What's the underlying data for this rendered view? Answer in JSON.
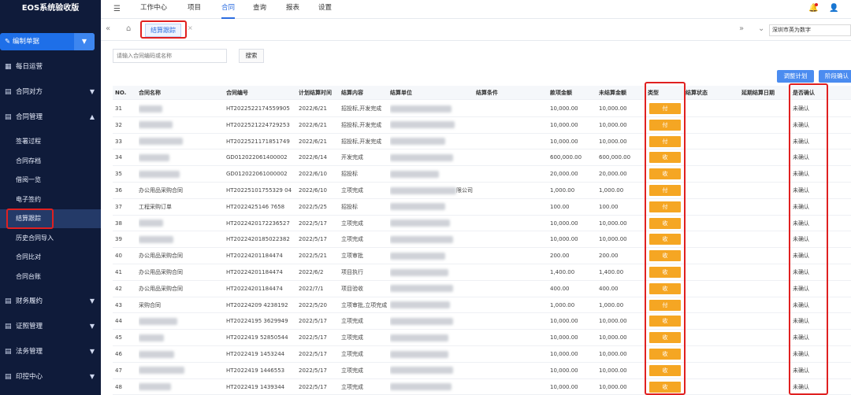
{
  "app": {
    "title": "EOS系统验收版"
  },
  "sidebar": {
    "workspace_button": "✎ 编制单据",
    "items_top": [
      {
        "icon": "grid-icon",
        "label": "每日运营"
      },
      {
        "icon": "document-icon",
        "label": "合同对方"
      },
      {
        "icon": "document-icon",
        "label": "合同管理"
      }
    ],
    "sub_items": [
      "签署过程",
      "合同存档",
      "借阅一览",
      "电子签约",
      "结算跟踪",
      "历史合同导入",
      "合同比对",
      "合同台账"
    ],
    "items_bottom": [
      {
        "icon": "document-icon",
        "label": "财务履约"
      },
      {
        "icon": "document-icon",
        "label": "证照管理"
      },
      {
        "icon": "document-icon",
        "label": "法务管理"
      },
      {
        "icon": "document-icon",
        "label": "印控中心"
      }
    ]
  },
  "topnav": {
    "items": [
      "工作中心",
      "项目",
      "合同",
      "查询",
      "报表",
      "设置"
    ],
    "active": "合同"
  },
  "tabs": {
    "active_label": "结算跟踪",
    "tenant": "深圳市英为数字"
  },
  "toolbar": {
    "search_placeholder": "请输入合同编码或名称",
    "search_label": "搜索",
    "adjust_plan_label": "调整计划",
    "stage_confirm_label": "阶段确认"
  },
  "table": {
    "headers": [
      "NO.",
      "合同名称",
      "合同编号",
      "计划结算时间",
      "结算内容",
      "结算单位",
      "结算条件",
      "款项金额",
      "未结算金额",
      "类型",
      "结算状态",
      "延期结算日期",
      "是否确认"
    ],
    "rows": [
      {
        "no": "31",
        "name": "",
        "code": "HT2022522174559905",
        "date": "2022/6/21",
        "content": "招投标,开发完成",
        "unit": "",
        "cond": "",
        "amount": "10,000.00",
        "unpaid": "10,000.00",
        "type": "付",
        "status": "",
        "delay": "",
        "confirm": "未确认"
      },
      {
        "no": "32",
        "name": "",
        "code": "HT2022521224729253",
        "date": "2022/6/21",
        "content": "招投标,开发完成",
        "unit": "",
        "cond": "",
        "amount": "10,000.00",
        "unpaid": "10,000.00",
        "type": "付",
        "status": "",
        "delay": "",
        "confirm": "未确认"
      },
      {
        "no": "33",
        "name": "",
        "code": "HT2022521171851749",
        "date": "2022/6/21",
        "content": "招投标,开发完成",
        "unit": "",
        "cond": "",
        "amount": "10,000.00",
        "unpaid": "10,000.00",
        "type": "付",
        "status": "",
        "delay": "",
        "confirm": "未确认"
      },
      {
        "no": "34",
        "name": "",
        "code": "GD012022061400002",
        "date": "2022/6/14",
        "content": "开发完成",
        "unit": "",
        "cond": "",
        "amount": "600,000.00",
        "unpaid": "600,000.00",
        "type": "收",
        "status": "",
        "delay": "",
        "confirm": "未确认"
      },
      {
        "no": "35",
        "name": "",
        "code": "GD012022061000002",
        "date": "2022/6/10",
        "content": "招投标",
        "unit": "",
        "cond": "",
        "amount": "20,000.00",
        "unpaid": "20,000.00",
        "type": "收",
        "status": "",
        "delay": "",
        "confirm": "未确认"
      },
      {
        "no": "36",
        "name": "办公用品采购合同",
        "code": "HT20225101755329 04",
        "date": "2022/6/10",
        "content": "立项完成",
        "unit": "",
        "unit_suffix": "限公司",
        "cond": "",
        "amount": "1,000.00",
        "unpaid": "1,000.00",
        "type": "付",
        "status": "",
        "delay": "",
        "confirm": "未确认"
      },
      {
        "no": "37",
        "name": "工程采购订单",
        "code": "HT2022425146 7658",
        "date": "2022/5/25",
        "content": "招投标",
        "unit": "",
        "cond": "",
        "amount": "100.00",
        "unpaid": "100.00",
        "type": "付",
        "status": "",
        "delay": "",
        "confirm": "未确认"
      },
      {
        "no": "38",
        "name": "",
        "code": "HT2022420172236527",
        "date": "2022/5/17",
        "content": "立项完成",
        "unit": "",
        "cond": "",
        "amount": "10,000.00",
        "unpaid": "10,000.00",
        "type": "收",
        "status": "",
        "delay": "",
        "confirm": "未确认"
      },
      {
        "no": "39",
        "name": "",
        "code": "HT2022420185022382",
        "date": "2022/5/17",
        "content": "立项完成",
        "unit": "",
        "cond": "",
        "amount": "10,000.00",
        "unpaid": "10,000.00",
        "type": "收",
        "status": "",
        "delay": "",
        "confirm": "未确认"
      },
      {
        "no": "40",
        "name": "办公用品采购合同",
        "code": "HT20224201184474",
        "date": "2022/5/21",
        "content": "立项审批",
        "unit": "",
        "cond": "",
        "amount": "200.00",
        "unpaid": "200.00",
        "type": "收",
        "status": "",
        "delay": "",
        "confirm": "未确认"
      },
      {
        "no": "41",
        "name": "办公用品采购合同",
        "code": "HT20224201184474",
        "date": "2022/6/2",
        "content": "项目执行",
        "unit": "",
        "cond": "",
        "amount": "1,400.00",
        "unpaid": "1,400.00",
        "type": "收",
        "status": "",
        "delay": "",
        "confirm": "未确认"
      },
      {
        "no": "42",
        "name": "办公用品采购合同",
        "code": "HT20224201184474",
        "date": "2022/7/1",
        "content": "项目验收",
        "unit": "",
        "cond": "",
        "amount": "400.00",
        "unpaid": "400.00",
        "type": "收",
        "status": "",
        "delay": "",
        "confirm": "未确认"
      },
      {
        "no": "43",
        "name": "采购合同",
        "code": "HT20224209 4238192",
        "date": "2022/5/20",
        "content": "立项审批,立项完成",
        "unit": "",
        "cond": "",
        "amount": "1,000.00",
        "unpaid": "1,000.00",
        "type": "付",
        "status": "",
        "delay": "",
        "confirm": "未确认"
      },
      {
        "no": "44",
        "name": "",
        "code": "HT20224195 3629949",
        "date": "2022/5/17",
        "content": "立项完成",
        "unit": "",
        "cond": "",
        "amount": "10,000.00",
        "unpaid": "10,000.00",
        "type": "收",
        "status": "",
        "delay": "",
        "confirm": "未确认"
      },
      {
        "no": "45",
        "name": "",
        "code": "HT2022419 52850544",
        "date": "2022/5/17",
        "content": "立项完成",
        "unit": "",
        "cond": "",
        "amount": "10,000.00",
        "unpaid": "10,000.00",
        "type": "收",
        "status": "",
        "delay": "",
        "confirm": "未确认"
      },
      {
        "no": "46",
        "name": "",
        "code": "HT2022419 1453244",
        "date": "2022/5/17",
        "content": "立项完成",
        "unit": "",
        "cond": "",
        "amount": "10,000.00",
        "unpaid": "10,000.00",
        "type": "收",
        "status": "",
        "delay": "",
        "confirm": "未确认"
      },
      {
        "no": "47",
        "name": "",
        "code": "HT2022419 1446553",
        "date": "2022/5/17",
        "content": "立项完成",
        "unit": "",
        "cond": "",
        "amount": "10,000.00",
        "unpaid": "10,000.00",
        "type": "收",
        "status": "",
        "delay": "",
        "confirm": "未确认"
      },
      {
        "no": "48",
        "name": "",
        "code": "HT2022419 1439344",
        "date": "2022/5/17",
        "content": "立项完成",
        "unit": "",
        "cond": "",
        "amount": "10,000.00",
        "unpaid": "10,000.00",
        "type": "收",
        "status": "",
        "delay": "",
        "confirm": "未确认"
      }
    ]
  },
  "colors": {
    "type_badge": "#f5a623",
    "sidebar_bg": "#0f1b3a",
    "accent": "#2c6de0",
    "highlight": "#e02020"
  }
}
